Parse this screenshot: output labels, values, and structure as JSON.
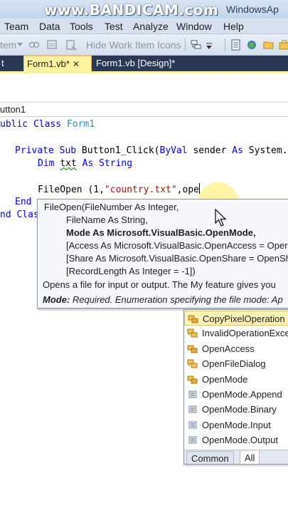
{
  "watermark": "www.BANDICAM.com",
  "window_title": "WindowsAp",
  "menu": [
    "Team",
    "Data",
    "Tools",
    "Test",
    "Analyze",
    "Window",
    "Help"
  ],
  "toolbar": {
    "item_label": "tem",
    "hide_work_item_icons": "Hide Work Item Icons"
  },
  "tabs": [
    {
      "label": "t",
      "active": false
    },
    {
      "label": "Form1.vb*",
      "active": true
    },
    {
      "label": "Form1.vb [Design]*",
      "active": false
    }
  ],
  "nav_combo": "utton1",
  "code": {
    "l1_kw": "ublic Class",
    "l1_type": "Form1",
    "l2_kw1": "Private Sub",
    "l2_name": "Button1_Click(",
    "l2_kw2": "ByVal",
    "l2_param": "sender",
    "l2_kw3": "As",
    "l2_rest": "System.",
    "l3_kw1": "Dim",
    "l3_var": "txt",
    "l3_kw2": "As String",
    "l4_call": "FileOpen (1,",
    "l4_str": "\"country.txt\"",
    "l4_rest": ",ope",
    "l5_kw": "End",
    "l6_kw": "nd Clas"
  },
  "param_info": {
    "line1": "FileOpen(FileNumber As Integer,",
    "line2": "FileName As String,",
    "line3": "Mode As Microsoft.VisualBasic.OpenMode,",
    "line4": "[Access As Microsoft.VisualBasic.OpenAccess = Oper",
    "line5": "[Share As Microsoft.VisualBasic.OpenShare = OpenSh",
    "line6": "[RecordLength As Integer = -1])",
    "description": "Opens a file for input or output. The My feature gives you",
    "param_name": "Mode:",
    "param_desc": "Required. Enumeration specifying the file mode: Ap"
  },
  "completion_list": {
    "items": [
      {
        "label": "CopyPixelOperation",
        "icon": "enum-icon",
        "selected": true
      },
      {
        "label": "InvalidOperationExce",
        "icon": "class-icon",
        "selected": false
      },
      {
        "label": "OpenAccess",
        "icon": "enum-icon",
        "selected": false
      },
      {
        "label": "OpenFileDialog",
        "icon": "class-icon",
        "selected": false
      },
      {
        "label": "OpenMode",
        "icon": "enum-icon",
        "selected": false
      },
      {
        "label": "OpenMode.Append",
        "icon": "enum-member-icon",
        "selected": false
      },
      {
        "label": "OpenMode.Binary",
        "icon": "enum-member-icon",
        "selected": false
      },
      {
        "label": "OpenMode.Input",
        "icon": "enum-member-icon",
        "selected": false
      },
      {
        "label": "OpenMode.Output",
        "icon": "enum-member-icon",
        "selected": false
      }
    ],
    "tab_common": "Common",
    "tab_all": "All"
  },
  "colors": {
    "keyword": "#0000ff",
    "type": "#2b91af",
    "string": "#a31515",
    "active_tab": "#fff29d",
    "tab_strip": "#293955"
  }
}
